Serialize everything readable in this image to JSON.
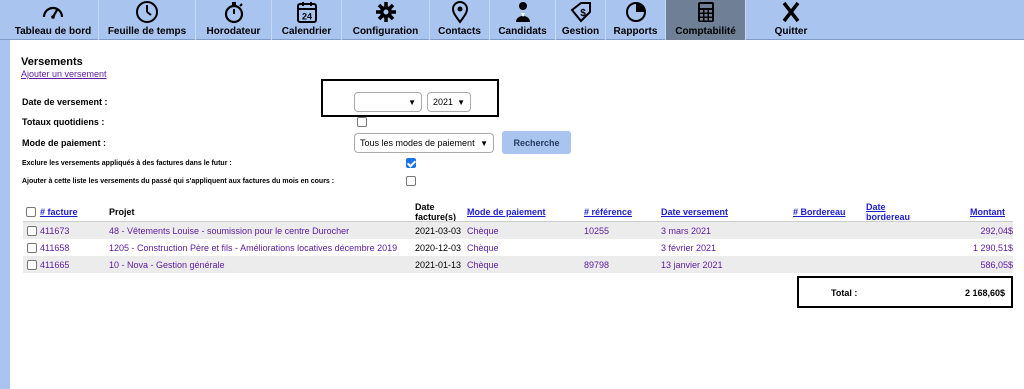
{
  "nav": [
    {
      "label": "Tableau de bord",
      "icon": "gauge-icon"
    },
    {
      "label": "Feuille de temps",
      "icon": "clock-icon"
    },
    {
      "label": "Horodateur",
      "icon": "stopwatch-icon"
    },
    {
      "label": "Calendrier",
      "icon": "calendar-icon",
      "day": "24"
    },
    {
      "label": "Configuration",
      "icon": "gear-icon"
    },
    {
      "label": "Contacts",
      "icon": "map-pin-icon"
    },
    {
      "label": "Candidats",
      "icon": "users-icon"
    },
    {
      "label": "Gestion",
      "icon": "price-tag-icon"
    },
    {
      "label": "Rapports",
      "icon": "pie-chart-icon"
    },
    {
      "label": "Comptabilité",
      "icon": "calculator-icon",
      "active": true
    },
    {
      "label": "Quitter",
      "icon": "x-icon"
    }
  ],
  "page": {
    "title": "Versements",
    "add_link": "Ajouter un versement"
  },
  "filters": {
    "date_label": "Date de versement :",
    "month_value": "",
    "year_value": "2021",
    "daily_totals_label": "Totaux quotidiens :",
    "daily_totals_checked": false,
    "payment_mode_label": "Mode de paiement :",
    "payment_mode_value": "Tous les modes de paiement",
    "search_button": "Recherche",
    "exclude_label": "Exclure les versements appliqués à des factures dans le futur :",
    "exclude_checked": true,
    "include_past_label": "Ajouter à cette liste les versements du passé qui s'appliquent aux factures du mois en cours :",
    "include_past_checked": false
  },
  "table": {
    "headers": {
      "invoice": "# facture",
      "project": "Projet",
      "invoice_date_1": "Date",
      "invoice_date_2": "facture(s)",
      "payment_mode": "Mode de paiement",
      "reference": "# référence",
      "payment_date": "Date versement",
      "bordereau": "# Bordereau",
      "bordereau_date_1": "Date",
      "bordereau_date_2": "bordereau",
      "amount": "Montant"
    },
    "rows": [
      {
        "invoice": "411673",
        "project": "48 - Vêtements Louise - soumission pour le centre Durocher",
        "invoice_date": "2021-03-03",
        "payment_mode": "Chèque",
        "reference": "10255",
        "payment_date": "3 mars 2021",
        "bordereau": "",
        "bordereau_date": "",
        "amount": "292,04$"
      },
      {
        "invoice": "411658",
        "project": "1205 - Construction Père et fils - Améliorations locatives décembre 2019",
        "invoice_date": "2020-12-03",
        "payment_mode": "Chèque",
        "reference": "",
        "payment_date": "3 février 2021",
        "bordereau": "",
        "bordereau_date": "",
        "amount": "1 290,51$"
      },
      {
        "invoice": "411665",
        "project": "10 - Nova - Gestion générale",
        "invoice_date": "2021-01-13",
        "payment_mode": "Chèque",
        "reference": "89798",
        "payment_date": "13 janvier 2021",
        "bordereau": "",
        "bordereau_date": "",
        "amount": "586,05$"
      }
    ],
    "total_label": "Total :",
    "total_value": "2 168,60$"
  },
  "colors": {
    "nav_bg": "#a9c4ee",
    "nav_active": "#6f7f96",
    "link_purple": "#5b1aa1",
    "link_blue": "#1c1ccf"
  }
}
